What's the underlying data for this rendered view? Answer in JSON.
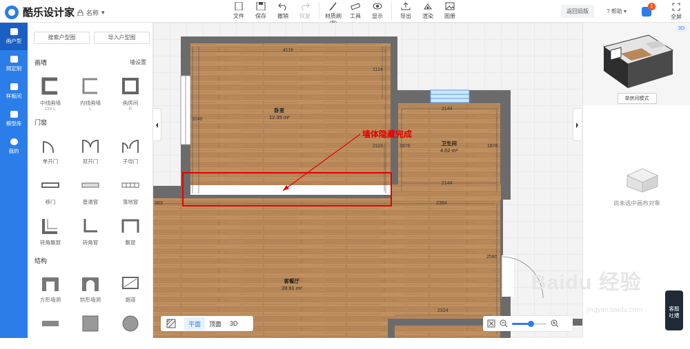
{
  "app": {
    "logo_text": "酷乐设计家",
    "file_name": "名称"
  },
  "toolbar": [
    {
      "label": "文件",
      "icon": "file-icon",
      "disabled": false
    },
    {
      "label": "保存",
      "icon": "save-icon",
      "disabled": false
    },
    {
      "label": "撤销",
      "icon": "undo-icon",
      "disabled": false
    },
    {
      "label": "恢复",
      "icon": "redo-icon",
      "disabled": true
    },
    {
      "label": "材质刷(B)",
      "icon": "brush-icon",
      "disabled": false
    },
    {
      "label": "工具",
      "icon": "ruler-icon",
      "disabled": false
    },
    {
      "label": "显示",
      "icon": "eye-icon",
      "disabled": false
    },
    {
      "label": "导出",
      "icon": "export-icon",
      "disabled": false
    },
    {
      "label": "渲染",
      "icon": "render-icon",
      "disabled": false
    },
    {
      "label": "图册",
      "icon": "album-icon",
      "disabled": false
    }
  ],
  "top_right": {
    "back_old": "返回旧版",
    "help": "帮助",
    "badge": "1",
    "fullscreen": "全屏"
  },
  "nav": [
    {
      "label": "画户型",
      "icon": "floorplan-icon",
      "active": true
    },
    {
      "label": "频定制",
      "icon": "custom-icon",
      "active": false
    },
    {
      "label": "样板间",
      "icon": "home-icon",
      "active": false
    },
    {
      "label": "模型库",
      "icon": "cube-icon",
      "active": false
    },
    {
      "label": "我的",
      "icon": "user-icon",
      "active": false
    }
  ],
  "panel": {
    "search_btn": "搜索户型图",
    "import_btn": "导入户型图",
    "wall_title": "画墙",
    "wall_settings": "墙设置",
    "wall_items": [
      {
        "label": "中线画墙",
        "sub": "Ctrl L"
      },
      {
        "label": "内线画墙",
        "sub": "L"
      },
      {
        "label": "画房间",
        "sub": "R"
      }
    ],
    "door_title": "门窗",
    "door_items": [
      {
        "label": "单开门"
      },
      {
        "label": "双开门"
      },
      {
        "label": "子母门"
      },
      {
        "label": "移门"
      },
      {
        "label": "普通窗"
      },
      {
        "label": "落地窗"
      },
      {
        "label": "转角飘窗"
      },
      {
        "label": "转角窗"
      },
      {
        "label": "飘窗"
      }
    ],
    "struct_title": "结构",
    "struct_items": [
      {
        "label": "方形墙洞"
      },
      {
        "label": "拱形墙洞"
      },
      {
        "label": "烟道"
      },
      {
        "label": ""
      },
      {
        "label": ""
      },
      {
        "label": ""
      }
    ]
  },
  "canvas": {
    "rooms": [
      {
        "name": "卧室",
        "area": "12.35 m²"
      },
      {
        "name": "卫生间",
        "area": "4.02 m²"
      },
      {
        "name": "客餐厅",
        "area": "28.91 m²"
      }
    ],
    "dims": [
      "4116",
      "1124",
      "3240",
      "2116",
      "2144",
      "1876",
      "1876",
      "2144",
      "2384",
      "2580",
      "2324",
      "383"
    ],
    "annotation": "墙体隐藏完成",
    "view_modes": [
      {
        "label": "平面",
        "active": true
      },
      {
        "label": "顶面",
        "active": false
      },
      {
        "label": "3D",
        "active": false
      }
    ],
    "zoom": 0.55
  },
  "right": {
    "mode_btn": "单房间模式",
    "btn_3d": "3D",
    "empty_text": "尚未选中画布对象"
  },
  "helper": {
    "line1": "客服",
    "line2": "吐槽"
  },
  "watermark": {
    "brand": "Baidu 经验",
    "url": "jingyan.baidu.com"
  }
}
